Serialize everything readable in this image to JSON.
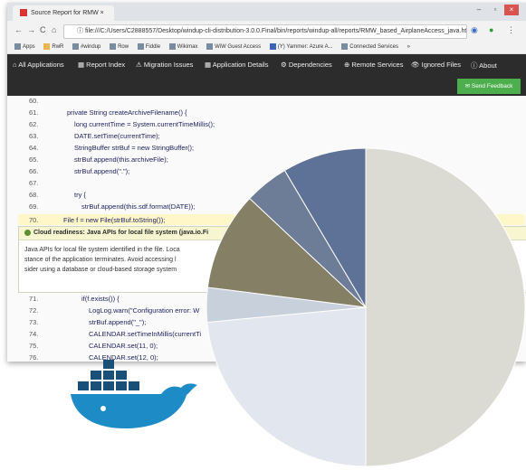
{
  "browser": {
    "tab_title": "Source Report for RMW ×",
    "tab_close": "×",
    "window_controls": [
      "–",
      "▫",
      "×"
    ],
    "address": "ⓘ file:///C:/Users/C2888557/Desktop/windup-cli-distribution-3.0.0.Final/bin/reports/windup-all/reports/RMW_based_AirplaneAccess_java.html?prej... ☆",
    "nav_back": "←",
    "nav_forward": "→",
    "nav_reload": "C",
    "nav_home": "⌂",
    "bookmarks": [
      "Apps",
      "RwR",
      "#windup",
      "Row",
      "Fiddle",
      "Wikimax",
      "WiW Guest Access",
      "(Y) Yammer: Azure A...",
      "Connected Services",
      "»"
    ]
  },
  "app_nav": {
    "items": [
      "All Applications",
      "Report Index",
      "Migration Issues",
      "Application Details",
      "Dependencies",
      "Remote Services",
      "Ignored Files",
      "About"
    ],
    "feedback_button": "Send Feedback"
  },
  "code": {
    "lines_top": [
      {
        "num": "60.",
        "text": ""
      },
      {
        "num": "61.",
        "text": "private String createArchiveFilename() {"
      },
      {
        "num": "62.",
        "text": "long currentTime = System.currentTimeMillis();"
      },
      {
        "num": "63.",
        "text": "DATE.setTime(currentTime);"
      },
      {
        "num": "64.",
        "text": "StringBuffer strBuf = new StringBuffer();"
      },
      {
        "num": "65.",
        "text": "strBuf.append(this.archiveFile);"
      },
      {
        "num": "66.",
        "text": "strBuf.append(\".\");"
      },
      {
        "num": "67.",
        "text": ""
      },
      {
        "num": "68.",
        "text": "try {"
      },
      {
        "num": "69.",
        "text": "strBuf.append(this.sdf.format(DATE));"
      }
    ],
    "highlight_line": {
      "num": "70.",
      "text": "File f = new File(strBuf.toString());"
    },
    "issue": {
      "title": "Cloud readiness: Java APIs for local file system (java.io.Fi",
      "body_lines": [
        "Java APIs for local file system identified in the file. Loca",
        "stance of the application terminates. Avoid accessing l",
        "sider using a database or cloud-based storage system"
      ]
    },
    "lines_bottom": [
      {
        "num": "71.",
        "text": "if(f.exists()) {"
      },
      {
        "num": "72.",
        "text": "LogLog.warn(\"Configuration error: W"
      },
      {
        "num": "73.",
        "text": "strBuf.append(\"_\");"
      },
      {
        "num": "74.",
        "text": "CALENDAR.setTimeInMillis(currentTi"
      },
      {
        "num": "75.",
        "text": "CALENDAR.set(11, 0);"
      },
      {
        "num": "76.",
        "text": "CALENDAR.set(12, 0);"
      }
    ]
  },
  "docker_logo": {
    "icon": "docker-whale-icon",
    "colors": {
      "whale": "#1d8bc6",
      "containers": "#1a4f78"
    }
  },
  "chart_data": {
    "type": "pie",
    "values": [
      50.0,
      23.5,
      3.5,
      10.0,
      4.5,
      8.5
    ],
    "colors": [
      "#dcdbd3",
      "#e2e6ee",
      "#c8d0dc",
      "#847f65",
      "#6d7d98",
      "#5e7196"
    ]
  }
}
